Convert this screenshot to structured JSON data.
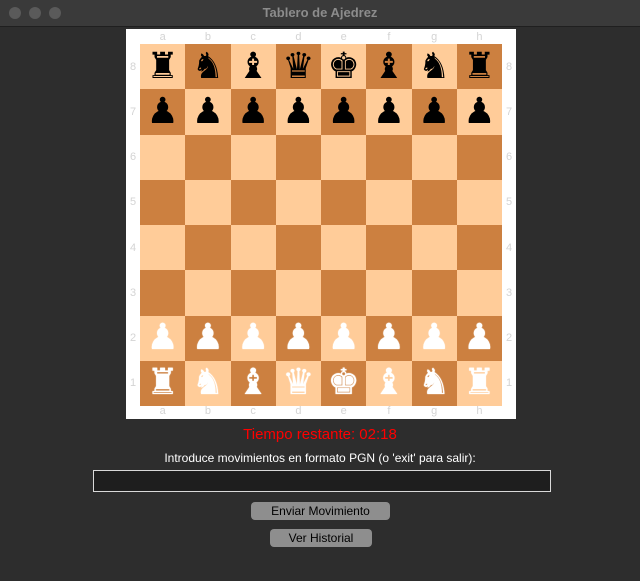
{
  "window": {
    "title": "Tablero de Ajedrez"
  },
  "board": {
    "files": [
      "a",
      "b",
      "c",
      "d",
      "e",
      "f",
      "g",
      "h"
    ],
    "ranks": [
      "8",
      "7",
      "6",
      "5",
      "4",
      "3",
      "2",
      "1"
    ],
    "light_color": "#ffcc99",
    "dark_color": "#cc8040",
    "position": [
      [
        "♜",
        "♞",
        "♝",
        "♛",
        "♚",
        "♝",
        "♞",
        "♜"
      ],
      [
        "♟",
        "♟",
        "♟",
        "♟",
        "♟",
        "♟",
        "♟",
        "♟"
      ],
      [
        "",
        "",
        "",
        "",
        "",
        "",
        "",
        ""
      ],
      [
        "",
        "",
        "",
        "",
        "",
        "",
        "",
        ""
      ],
      [
        "",
        "",
        "",
        "",
        "",
        "",
        "",
        ""
      ],
      [
        "",
        "",
        "",
        "",
        "",
        "",
        "",
        ""
      ],
      [
        "♟",
        "♟",
        "♟",
        "♟",
        "♟",
        "♟",
        "♟",
        "♟"
      ],
      [
        "♜",
        "♞",
        "♝",
        "♛",
        "♚",
        "♝",
        "♞",
        "♜"
      ]
    ],
    "piece_colors": [
      [
        "black",
        "black",
        "black",
        "black",
        "black",
        "black",
        "black",
        "black"
      ],
      [
        "black",
        "black",
        "black",
        "black",
        "black",
        "black",
        "black",
        "black"
      ],
      [
        "",
        "",
        "",
        "",
        "",
        "",
        "",
        ""
      ],
      [
        "",
        "",
        "",
        "",
        "",
        "",
        "",
        ""
      ],
      [
        "",
        "",
        "",
        "",
        "",
        "",
        "",
        ""
      ],
      [
        "",
        "",
        "",
        "",
        "",
        "",
        "",
        ""
      ],
      [
        "white",
        "white",
        "white",
        "white",
        "white",
        "white",
        "white",
        "white"
      ],
      [
        "white",
        "white",
        "white",
        "white",
        "white",
        "white",
        "white",
        "white"
      ]
    ]
  },
  "timer": {
    "text": "Tiempo restante: 02:18",
    "color": "#ff0000"
  },
  "prompt": {
    "text": "Introduce movimientos en formato PGN (o 'exit' para salir):"
  },
  "move_input": {
    "value": "",
    "placeholder": ""
  },
  "buttons": {
    "send_label": "Enviar Movimiento",
    "history_label": "Ver Historial"
  }
}
